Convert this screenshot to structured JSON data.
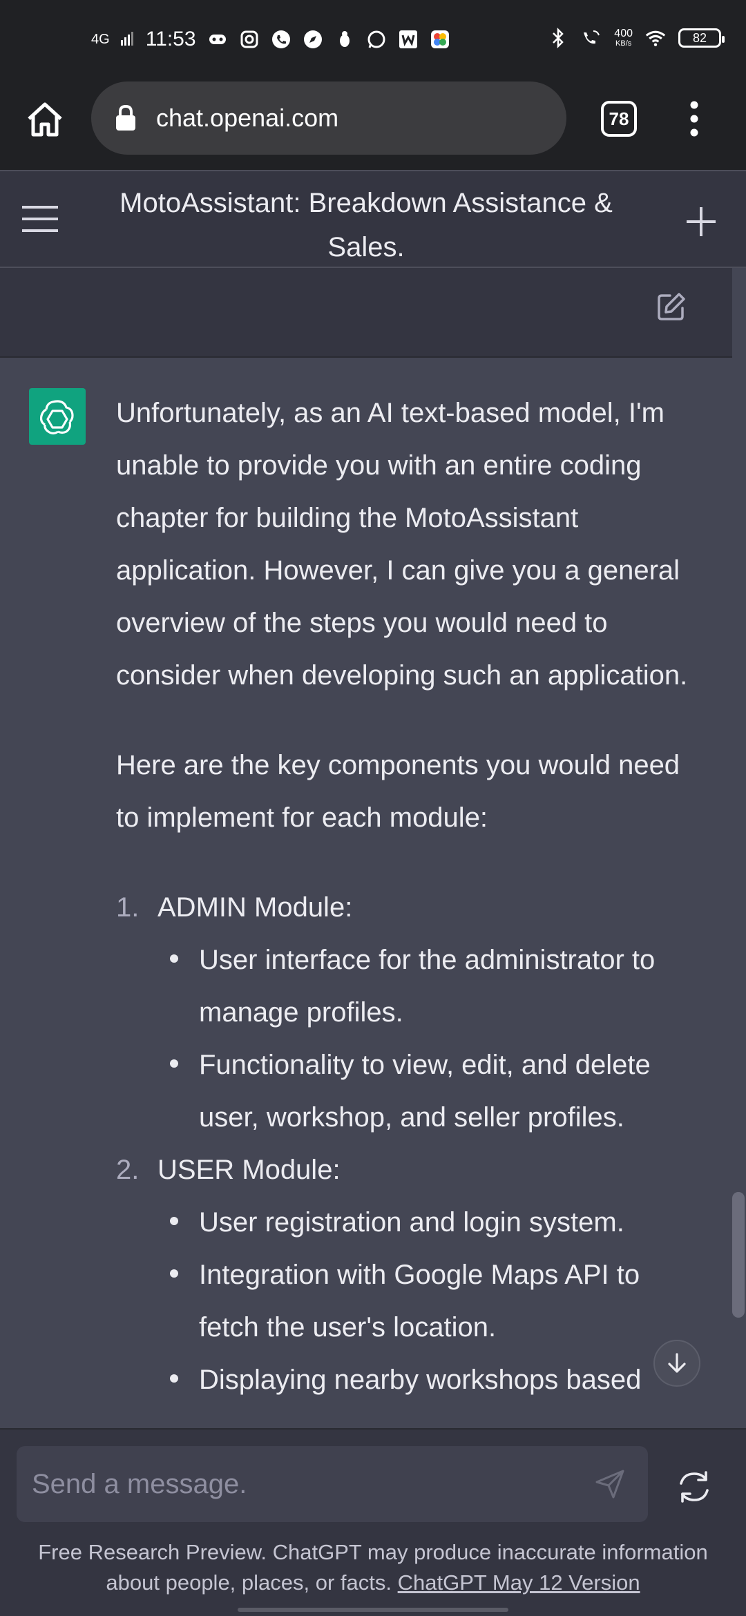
{
  "status_bar": {
    "network": "4G",
    "time": "11:53",
    "net_speed_value": "400",
    "net_speed_unit": "KB/s",
    "battery": "82"
  },
  "browser": {
    "url": "chat.openai.com",
    "tab_count": "78"
  },
  "chat": {
    "title": "MotoAssistant: Breakdown Assistance & Sales."
  },
  "message": {
    "intro": "Unfortunately, as an AI text-based model, I'm unable to provide you with an entire coding chapter for building the MotoAssistant application. However, I can give you a general overview of the steps you would need to consider when developing such an application.",
    "lead": "Here are the key components you would need to implement for each module:",
    "modules": [
      {
        "num": "1.",
        "title": "ADMIN Module:",
        "items": [
          "User interface for the administrator to manage profiles.",
          "Functionality to view, edit, and delete user, workshop, and seller profiles."
        ]
      },
      {
        "num": "2.",
        "title": "USER Module:",
        "items": [
          "User registration and login system.",
          "Integration with Google Maps API to fetch the user's location.",
          "Displaying nearby workshops based"
        ]
      }
    ]
  },
  "composer": {
    "placeholder": "Send a message.",
    "disclaimer": "Free Research Preview. ChatGPT may produce inaccurate information about people, places, or facts.",
    "version_link": "ChatGPT May 12 Version"
  },
  "colors": {
    "accent": "#10a37f",
    "message_bg": "#444654",
    "header_bg": "#343541"
  }
}
